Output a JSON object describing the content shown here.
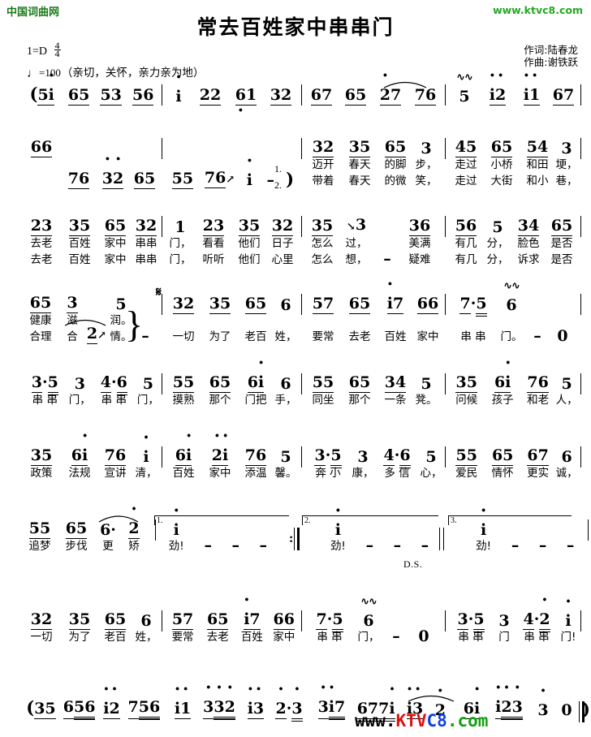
{
  "header": {
    "site_tag": "中国词曲网",
    "site_url": "www.ktvc8.com",
    "title": "常去百姓家中串串门",
    "lyricist": "作词:陆春龙",
    "composer": "作曲:谢铁跃"
  },
  "music_info": {
    "key_prefix": "1",
    "key_equals": "=",
    "key": "D",
    "meter_top": "4",
    "meter_bottom": "4",
    "tempo_note": "♩",
    "tempo_equals": "=",
    "tempo_value": "100",
    "mood": "（亲切，关怀，亲力亲为地）"
  },
  "marks": {
    "segno": "𝄋",
    "ds": "D.S.",
    "volta1": "1.",
    "volta2": "2.",
    "volta3": "3.",
    "verse1": "1.",
    "verse2": "2."
  },
  "lines": [
    {
      "id": "line1",
      "measures": [
        {
          "cells": [
            {
              "notes": "(5i",
              "lyric1": "",
              "lyric2": ""
            },
            {
              "notes": "65",
              "lyric1": "",
              "lyric2": ""
            },
            {
              "notes": "53",
              "lyric1": "",
              "lyric2": ""
            },
            {
              "notes": "56",
              "lyric1": "",
              "lyric2": ""
            }
          ]
        },
        {
          "cells": [
            {
              "notes": "i",
              "lyric1": "",
              "lyric2": ""
            },
            {
              "notes": "22",
              "lyric1": "",
              "lyric2": ""
            },
            {
              "notes": "61",
              "lyric1": "",
              "lyric2": ""
            },
            {
              "notes": "32",
              "lyric1": "",
              "lyric2": ""
            }
          ]
        },
        {
          "cells": [
            {
              "notes": "67",
              "lyric1": "",
              "lyric2": ""
            },
            {
              "notes": "65",
              "lyric1": "",
              "lyric2": ""
            },
            {
              "notes": "27",
              "lyric1": "",
              "lyric2": ""
            },
            {
              "notes": "76",
              "lyric1": "",
              "lyric2": ""
            }
          ]
        },
        {
          "cells": [
            {
              "notes": "5",
              "lyric1": "",
              "lyric2": ""
            },
            {
              "notes": "i2",
              "lyric1": "",
              "lyric2": ""
            },
            {
              "notes": "i1",
              "lyric1": "",
              "lyric2": ""
            },
            {
              "notes": "67",
              "lyric1": "",
              "lyric2": ""
            }
          ]
        }
      ]
    },
    {
      "id": "line2",
      "measures": [
        {
          "cells": [
            {
              "notes": "66",
              "lyric1": "",
              "lyric2": ""
            },
            {
              "notes": "76",
              "lyric1": "",
              "lyric2": ""
            },
            {
              "notes": "32",
              "lyric1": "",
              "lyric2": ""
            },
            {
              "notes": "65",
              "lyric1": "",
              "lyric2": ""
            }
          ]
        },
        {
          "cells": [
            {
              "notes": "55",
              "lyric1": "",
              "lyric2": ""
            },
            {
              "notes": "76",
              "lyric1": "",
              "lyric2": ""
            },
            {
              "notes": "i",
              "lyric1": "",
              "lyric2": ""
            },
            {
              "notes": "–",
              "lyric1": "",
              "lyric2": ""
            },
            {
              "notes": ")",
              "lyric1": "",
              "lyric2": ""
            }
          ]
        },
        {
          "cells": [
            {
              "notes": "32",
              "lyric1": "迈开",
              "lyric2": "带着"
            },
            {
              "notes": "35",
              "lyric1": "春天",
              "lyric2": "春天"
            },
            {
              "notes": "65",
              "lyric1": "的脚",
              "lyric2": "的微"
            },
            {
              "notes": "3",
              "lyric1": "步，",
              "lyric2": "笑，"
            }
          ]
        },
        {
          "cells": [
            {
              "notes": "45",
              "lyric1": "走过",
              "lyric2": "走过"
            },
            {
              "notes": "65",
              "lyric1": "小桥",
              "lyric2": "大街"
            },
            {
              "notes": "54",
              "lyric1": "和田",
              "lyric2": "和小"
            },
            {
              "notes": "3",
              "lyric1": "埂，",
              "lyric2": "巷，"
            }
          ]
        }
      ]
    },
    {
      "id": "line3",
      "measures": [
        {
          "cells": [
            {
              "notes": "23",
              "lyric1": "去老",
              "lyric2": "去老"
            },
            {
              "notes": "35",
              "lyric1": "百姓",
              "lyric2": "百姓"
            },
            {
              "notes": "65",
              "lyric1": "家中",
              "lyric2": "家中"
            },
            {
              "notes": "32",
              "lyric1": "串串",
              "lyric2": "串串"
            }
          ]
        },
        {
          "cells": [
            {
              "notes": "1",
              "lyric1": "门，",
              "lyric2": "门，"
            },
            {
              "notes": "23",
              "lyric1": "看看",
              "lyric2": "听听"
            },
            {
              "notes": "35",
              "lyric1": "他们",
              "lyric2": "他们"
            },
            {
              "notes": "32",
              "lyric1": "日子",
              "lyric2": "心里"
            }
          ]
        },
        {
          "cells": [
            {
              "notes": "35",
              "lyric1": "怎么",
              "lyric2": "怎么"
            },
            {
              "notes": "3",
              "lyric1": "过，",
              "lyric2": "想，"
            },
            {
              "notes": "–",
              "lyric1": "",
              "lyric2": ""
            },
            {
              "notes": "36",
              "lyric1": "美满",
              "lyric2": "疑难"
            }
          ]
        },
        {
          "cells": [
            {
              "notes": "56",
              "lyric1": "有几",
              "lyric2": "有几"
            },
            {
              "notes": "5",
              "lyric1": "分，",
              "lyric2": "分，"
            },
            {
              "notes": "34",
              "lyric1": "脸色",
              "lyric2": "诉求"
            },
            {
              "notes": "65",
              "lyric1": "是否",
              "lyric2": "是否"
            }
          ]
        }
      ]
    },
    {
      "id": "line4",
      "measures": [
        {
          "cells": [
            {
              "notes": "65",
              "lyric1": "健康",
              "lyric2": "合理"
            },
            {
              "notes": "3",
              "lyric1": "滋",
              "lyric2": "合"
            },
            {
              "notes": "2",
              "lyric1": "",
              "lyric2": ""
            },
            {
              "notes": "5",
              "lyric1": "润。",
              "lyric2": "情。"
            },
            {
              "notes": "–",
              "lyric1": "",
              "lyric2": ""
            }
          ]
        },
        {
          "cells": [
            {
              "notes": "32",
              "lyric1": "一切",
              "lyric2": ""
            },
            {
              "notes": "35",
              "lyric1": "为了",
              "lyric2": ""
            },
            {
              "notes": "65",
              "lyric1": "老百",
              "lyric2": ""
            },
            {
              "notes": "6",
              "lyric1": "姓，",
              "lyric2": ""
            }
          ]
        },
        {
          "cells": [
            {
              "notes": "57",
              "lyric1": "要常",
              "lyric2": ""
            },
            {
              "notes": "65",
              "lyric1": "去老",
              "lyric2": ""
            },
            {
              "notes": "i7",
              "lyric1": "百姓",
              "lyric2": ""
            },
            {
              "notes": "66",
              "lyric1": "家中",
              "lyric2": ""
            }
          ]
        },
        {
          "cells": [
            {
              "notes": "7·5",
              "lyric1": "串 串",
              "lyric2": ""
            },
            {
              "notes": "6",
              "lyric1": "门。",
              "lyric2": ""
            },
            {
              "notes": "–",
              "lyric1": "",
              "lyric2": ""
            },
            {
              "notes": "0",
              "lyric1": "",
              "lyric2": ""
            }
          ]
        }
      ]
    },
    {
      "id": "line5",
      "measures": [
        {
          "cells": [
            {
              "notes": "3·5",
              "lyric1": "串 串",
              "lyric2": ""
            },
            {
              "notes": "3",
              "lyric1": "门，",
              "lyric2": ""
            },
            {
              "notes": "4·6",
              "lyric1": "串 串",
              "lyric2": ""
            },
            {
              "notes": "5",
              "lyric1": "门，",
              "lyric2": ""
            }
          ]
        },
        {
          "cells": [
            {
              "notes": "55",
              "lyric1": "摸熟",
              "lyric2": ""
            },
            {
              "notes": "65",
              "lyric1": "那个",
              "lyric2": ""
            },
            {
              "notes": "6i",
              "lyric1": "门把",
              "lyric2": ""
            },
            {
              "notes": "6",
              "lyric1": "手，",
              "lyric2": ""
            }
          ]
        },
        {
          "cells": [
            {
              "notes": "55",
              "lyric1": "同坐",
              "lyric2": ""
            },
            {
              "notes": "65",
              "lyric1": "那个",
              "lyric2": ""
            },
            {
              "notes": "34",
              "lyric1": "一条",
              "lyric2": ""
            },
            {
              "notes": "5",
              "lyric1": "凳。",
              "lyric2": ""
            }
          ]
        },
        {
          "cells": [
            {
              "notes": "35",
              "lyric1": "问候",
              "lyric2": ""
            },
            {
              "notes": "6i",
              "lyric1": "孩子",
              "lyric2": ""
            },
            {
              "notes": "76",
              "lyric1": "和老",
              "lyric2": ""
            },
            {
              "notes": "5",
              "lyric1": "人，",
              "lyric2": ""
            }
          ]
        }
      ]
    },
    {
      "id": "line6",
      "measures": [
        {
          "cells": [
            {
              "notes": "35",
              "lyric1": "政策",
              "lyric2": ""
            },
            {
              "notes": "6i",
              "lyric1": "法规",
              "lyric2": ""
            },
            {
              "notes": "76",
              "lyric1": "宣讲",
              "lyric2": ""
            },
            {
              "notes": "i",
              "lyric1": "清，",
              "lyric2": ""
            }
          ]
        },
        {
          "cells": [
            {
              "notes": "6i",
              "lyric1": "百姓",
              "lyric2": ""
            },
            {
              "notes": "2i",
              "lyric1": "家中",
              "lyric2": ""
            },
            {
              "notes": "76",
              "lyric1": "添温",
              "lyric2": ""
            },
            {
              "notes": "5",
              "lyric1": "馨。",
              "lyric2": ""
            }
          ]
        },
        {
          "cells": [
            {
              "notes": "3·5",
              "lyric1": "奔 小",
              "lyric2": ""
            },
            {
              "notes": "3",
              "lyric1": "康，",
              "lyric2": ""
            },
            {
              "notes": "4·6",
              "lyric1": "多 信",
              "lyric2": ""
            },
            {
              "notes": "5",
              "lyric1": "心，",
              "lyric2": ""
            }
          ]
        },
        {
          "cells": [
            {
              "notes": "55",
              "lyric1": "爱民",
              "lyric2": ""
            },
            {
              "notes": "65",
              "lyric1": "情怀",
              "lyric2": ""
            },
            {
              "notes": "67",
              "lyric1": "更实",
              "lyric2": ""
            },
            {
              "notes": "6",
              "lyric1": "诚，",
              "lyric2": ""
            }
          ]
        }
      ]
    },
    {
      "id": "line7",
      "measures": [
        {
          "cells": [
            {
              "notes": "55",
              "lyric1": "追梦",
              "lyric2": ""
            },
            {
              "notes": "65",
              "lyric1": "步伐",
              "lyric2": ""
            },
            {
              "notes": "6·",
              "lyric1": "更",
              "lyric2": ""
            },
            {
              "notes": "2",
              "lyric1": "矫",
              "lyric2": ""
            }
          ]
        },
        {
          "cells": [
            {
              "notes": "i",
              "lyric1": "劲!",
              "lyric2": ""
            },
            {
              "notes": "–",
              "lyric1": "",
              "lyric2": ""
            },
            {
              "notes": "–",
              "lyric1": "",
              "lyric2": ""
            },
            {
              "notes": "–",
              "lyric1": "",
              "lyric2": ""
            }
          ]
        },
        {
          "cells": [
            {
              "notes": "i",
              "lyric1": "劲!",
              "lyric2": ""
            },
            {
              "notes": "–",
              "lyric1": "",
              "lyric2": ""
            },
            {
              "notes": "–",
              "lyric1": "",
              "lyric2": ""
            },
            {
              "notes": "–",
              "lyric1": "",
              "lyric2": ""
            }
          ]
        },
        {
          "cells": [
            {
              "notes": "i",
              "lyric1": "劲!",
              "lyric2": ""
            },
            {
              "notes": "–",
              "lyric1": "",
              "lyric2": ""
            },
            {
              "notes": "–",
              "lyric1": "",
              "lyric2": ""
            },
            {
              "notes": "–",
              "lyric1": "",
              "lyric2": ""
            }
          ]
        }
      ]
    },
    {
      "id": "line8",
      "measures": [
        {
          "cells": [
            {
              "notes": "32",
              "lyric1": "一切",
              "lyric2": ""
            },
            {
              "notes": "35",
              "lyric1": "为了",
              "lyric2": ""
            },
            {
              "notes": "65",
              "lyric1": "老百",
              "lyric2": ""
            },
            {
              "notes": "6",
              "lyric1": "姓，",
              "lyric2": ""
            }
          ]
        },
        {
          "cells": [
            {
              "notes": "57",
              "lyric1": "要常",
              "lyric2": ""
            },
            {
              "notes": "65",
              "lyric1": "去老",
              "lyric2": ""
            },
            {
              "notes": "i7",
              "lyric1": "百姓",
              "lyric2": ""
            },
            {
              "notes": "66",
              "lyric1": "家中",
              "lyric2": ""
            }
          ]
        },
        {
          "cells": [
            {
              "notes": "7·5",
              "lyric1": "串 串",
              "lyric2": ""
            },
            {
              "notes": "6",
              "lyric1": "门，",
              "lyric2": ""
            },
            {
              "notes": "–",
              "lyric1": "",
              "lyric2": ""
            },
            {
              "notes": "0",
              "lyric1": "",
              "lyric2": ""
            }
          ]
        },
        {
          "cells": [
            {
              "notes": "3·5",
              "lyric1": "串 串",
              "lyric2": ""
            },
            {
              "notes": "3",
              "lyric1": "门",
              "lyric2": ""
            },
            {
              "notes": "4·2",
              "lyric1": "串 串",
              "lyric2": ""
            },
            {
              "notes": "i",
              "lyric1": "门!",
              "lyric2": ""
            }
          ]
        }
      ]
    },
    {
      "id": "line9",
      "measures": [
        {
          "cells": [
            {
              "notes": "(35",
              "lyric1": "",
              "lyric2": ""
            },
            {
              "notes": "656",
              "lyric1": "",
              "lyric2": ""
            },
            {
              "notes": "i2",
              "lyric1": "",
              "lyric2": ""
            },
            {
              "notes": "756",
              "lyric1": "",
              "lyric2": ""
            }
          ]
        },
        {
          "cells": [
            {
              "notes": "i1",
              "lyric1": "",
              "lyric2": ""
            },
            {
              "notes": "332",
              "lyric1": "",
              "lyric2": ""
            },
            {
              "notes": "i3",
              "lyric1": "",
              "lyric2": ""
            },
            {
              "notes": "2·3",
              "lyric1": "",
              "lyric2": ""
            }
          ]
        },
        {
          "cells": [
            {
              "notes": "3i7",
              "lyric1": "",
              "lyric2": ""
            },
            {
              "notes": "677i",
              "lyric1": "",
              "lyric2": ""
            },
            {
              "notes": "i3",
              "lyric1": "",
              "lyric2": ""
            },
            {
              "notes": "2",
              "lyric1": "",
              "lyric2": ""
            }
          ]
        },
        {
          "cells": [
            {
              "notes": "6i",
              "lyric1": "",
              "lyric2": ""
            },
            {
              "notes": "i23",
              "lyric1": "",
              "lyric2": ""
            },
            {
              "notes": "3",
              "lyric1": "",
              "lyric2": ""
            },
            {
              "notes": "0",
              "lyric1": "",
              "lyric2": ""
            },
            {
              "notes": ")",
              "lyric1": "",
              "lyric2": ""
            }
          ]
        }
      ]
    }
  ],
  "watermark": {
    "text": "www.KTVC8.com",
    "colors": {
      "www": "#000000",
      "ktvc": "#e01010",
      "eight": "#1040e0",
      "com": "#11a011"
    }
  }
}
